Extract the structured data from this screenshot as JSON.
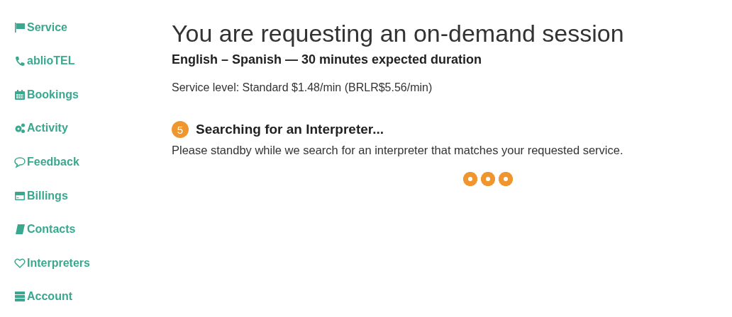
{
  "sidebar": {
    "items": [
      {
        "label": "Service"
      },
      {
        "label": "ablioTEL"
      },
      {
        "label": "Bookings"
      },
      {
        "label": "Activity"
      },
      {
        "label": "Feedback"
      },
      {
        "label": "Billings"
      },
      {
        "label": "Contacts"
      },
      {
        "label": "Interpreters"
      },
      {
        "label": "Account"
      }
    ]
  },
  "main": {
    "title": "You are requesting an on-demand session",
    "languages": "English – Spanish — 30 minutes expected duration",
    "service_level": "Service level: Standard $1.48/min (BRLR$5.56/min)",
    "step": {
      "number": "5",
      "title": "Searching for an Interpreter...",
      "message": "Please standby while we search for an interpreter that matches your requested service."
    }
  }
}
